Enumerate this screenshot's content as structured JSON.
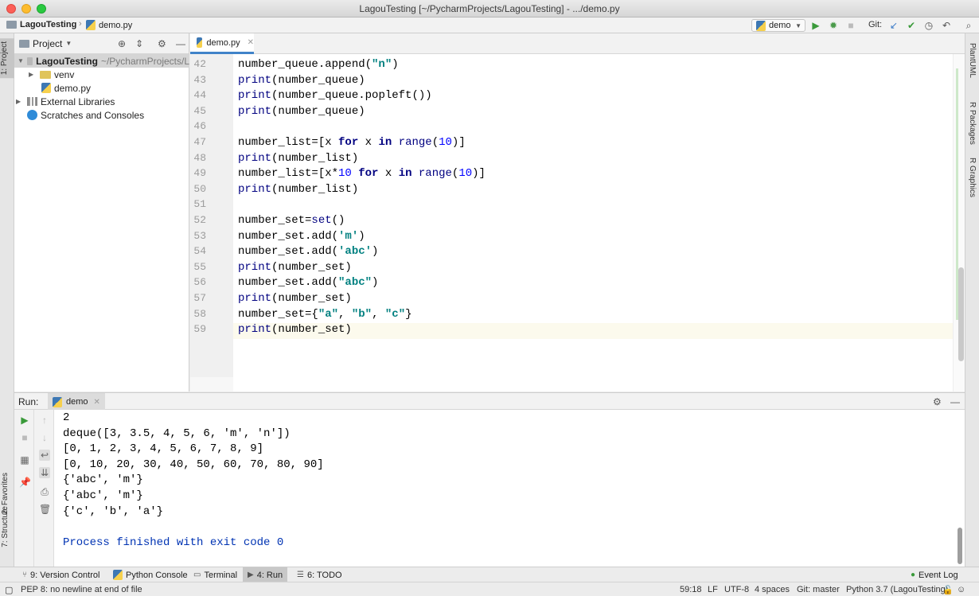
{
  "window": {
    "title": "LagouTesting [~/PycharmProjects/LagouTesting] - .../demo.py"
  },
  "breadcrumb": {
    "project": "LagouTesting",
    "file": "demo.py"
  },
  "toolbar": {
    "run_config": "demo",
    "git_label": "Git:"
  },
  "left_stripe": {
    "project_tab": "1: Project",
    "favorites_tab": "2: Favorites",
    "structure_tab": "7: Structure"
  },
  "right_stripe": {
    "tabs": [
      "PlantUML",
      "R Packages",
      "R Graphics"
    ]
  },
  "project_panel": {
    "title": "Project",
    "root": {
      "name": "LagouTesting",
      "path": "~/PycharmProjects/L"
    },
    "items": [
      {
        "name": "venv"
      },
      {
        "name": "demo.py"
      },
      {
        "name": "External Libraries"
      },
      {
        "name": "Scratches and Consoles"
      }
    ]
  },
  "editor": {
    "tab": "demo.py",
    "line_numbers": [
      "42",
      "43",
      "44",
      "45",
      "46",
      "47",
      "48",
      "49",
      "50",
      "51",
      "52",
      "53",
      "54",
      "55",
      "56",
      "57",
      "58",
      "59"
    ],
    "lines": [
      "number_queue.append(\"n\")",
      "print(number_queue)",
      "print(number_queue.popleft())",
      "print(number_queue)",
      "",
      "number_list=[x for x in range(10)]",
      "print(number_list)",
      "number_list=[x*10 for x in range(10)]",
      "print(number_list)",
      "",
      "number_set=set()",
      "number_set.add('m')",
      "number_set.add('abc')",
      "print(number_set)",
      "number_set.add(\"abc\")",
      "print(number_set)",
      "number_set={\"a\", \"b\", \"c\"}",
      "print(number_set)"
    ]
  },
  "run_panel": {
    "label": "Run:",
    "tab": "demo",
    "output": [
      "2",
      "deque([3, 3.5, 4, 5, 6, 'm', 'n'])",
      "[0, 1, 2, 3, 4, 5, 6, 7, 8, 9]",
      "[0, 10, 20, 30, 40, 50, 60, 70, 80, 90]",
      "{'abc', 'm'}",
      "{'abc', 'm'}",
      "{'c', 'b', 'a'}",
      "",
      "Process finished with exit code 0"
    ]
  },
  "bottom_tabs": [
    {
      "label": "9: Version Control"
    },
    {
      "label": "Python Console"
    },
    {
      "label": "Terminal"
    },
    {
      "label": "4: Run"
    },
    {
      "label": "6: TODO"
    }
  ],
  "event_log": "Event Log",
  "status": {
    "message": "PEP 8: no newline at end of file",
    "position": "59:18",
    "line_sep": "LF",
    "encoding": "UTF-8",
    "indent": "4 spaces",
    "git": "Git: master",
    "interpreter": "Python 3.7 (LagouTesting)"
  }
}
